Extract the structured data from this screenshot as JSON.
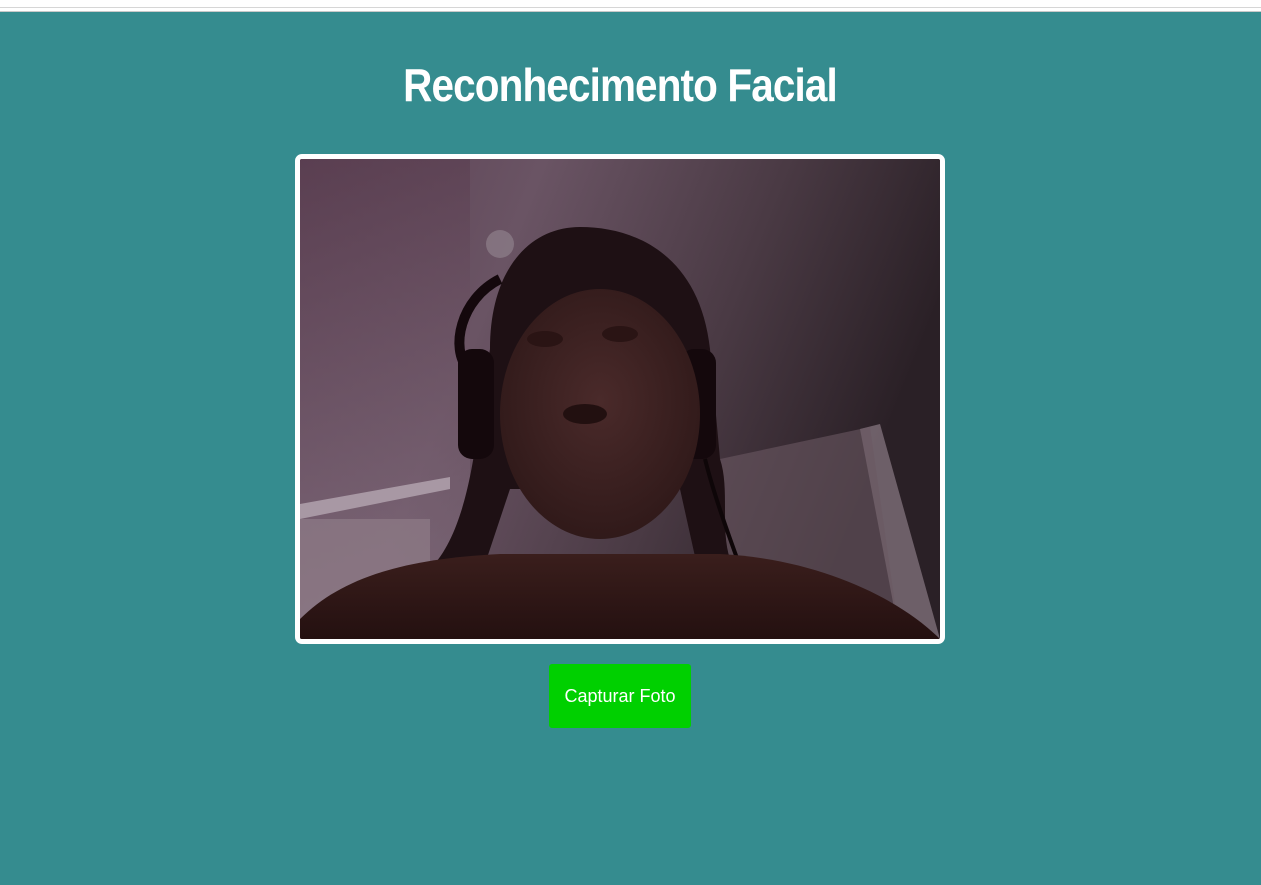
{
  "page": {
    "title": "Reconhecimento Facial",
    "background_color": "#358c8f"
  },
  "webcam": {
    "description_icon": "webcam-feed",
    "border_color": "#ffffff"
  },
  "actions": {
    "capture_label": "Capturar Foto",
    "capture_color": "#00d000"
  }
}
